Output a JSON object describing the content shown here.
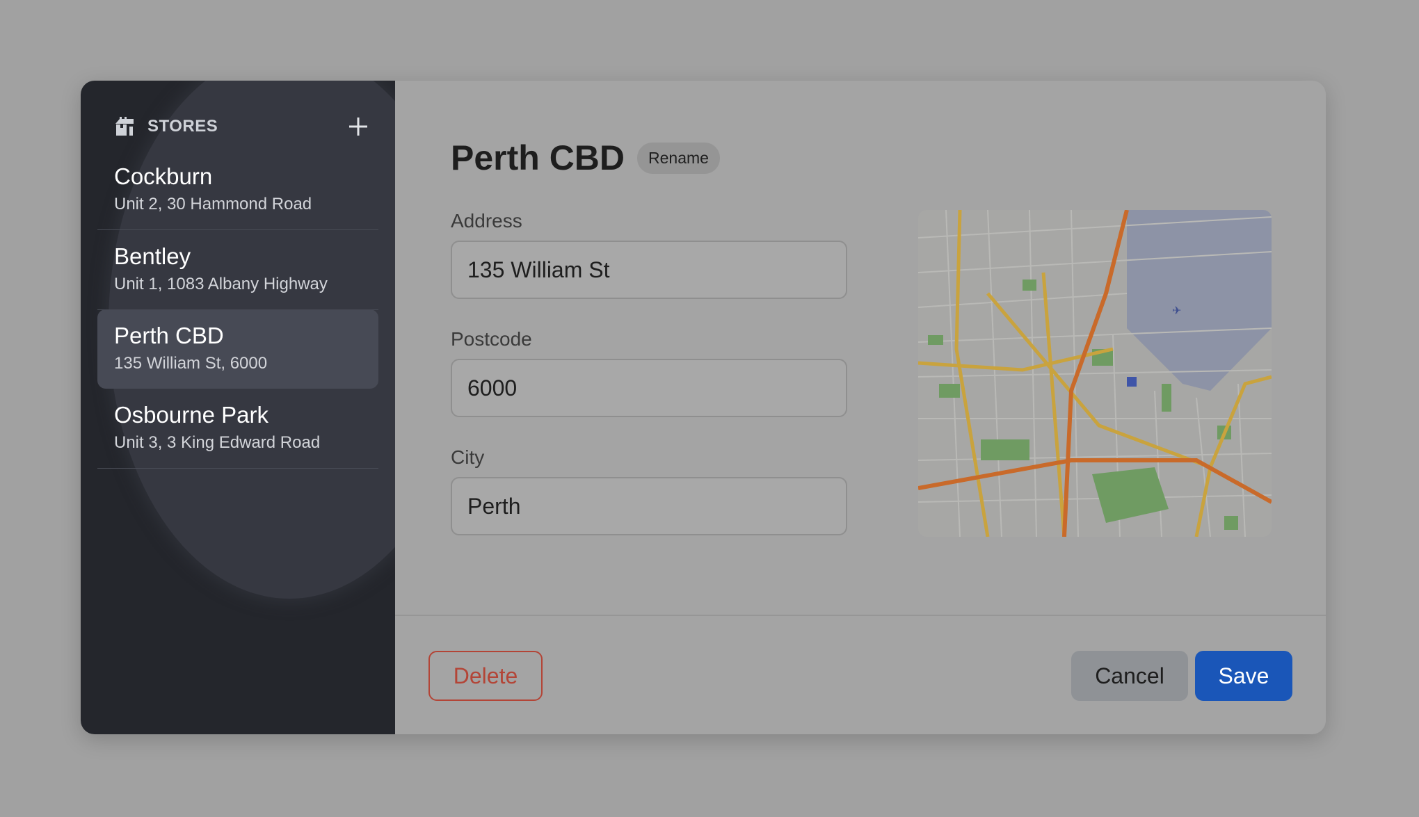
{
  "sidebar": {
    "title": "STORES",
    "header_icon": "store-icon",
    "add_icon": "plus-icon",
    "stores": [
      {
        "name": "Cockburn",
        "address": "Unit 2, 30 Hammond Road"
      },
      {
        "name": "Bentley",
        "address": "Unit 1, 1083 Albany Highway"
      },
      {
        "name": "Perth CBD",
        "address": "135 William St, 6000"
      },
      {
        "name": "Osbourne Park",
        "address": "Unit 3, 3 King Edward Road"
      }
    ],
    "active_index": 2
  },
  "detail": {
    "title": "Perth CBD",
    "rename_label": "Rename",
    "address_label": "Address",
    "address_value": "135 William St",
    "postcode_label": "Postcode",
    "postcode_value": "6000",
    "city_label": "City",
    "city_value": "Perth"
  },
  "footer": {
    "delete_label": "Delete",
    "cancel_label": "Cancel",
    "save_label": "Save"
  },
  "colors": {
    "sidebar_bg": "#24262c",
    "active_item": "#474a55",
    "save": "#1a56b8",
    "delete": "#b34537",
    "cancel": "#8f9296"
  }
}
